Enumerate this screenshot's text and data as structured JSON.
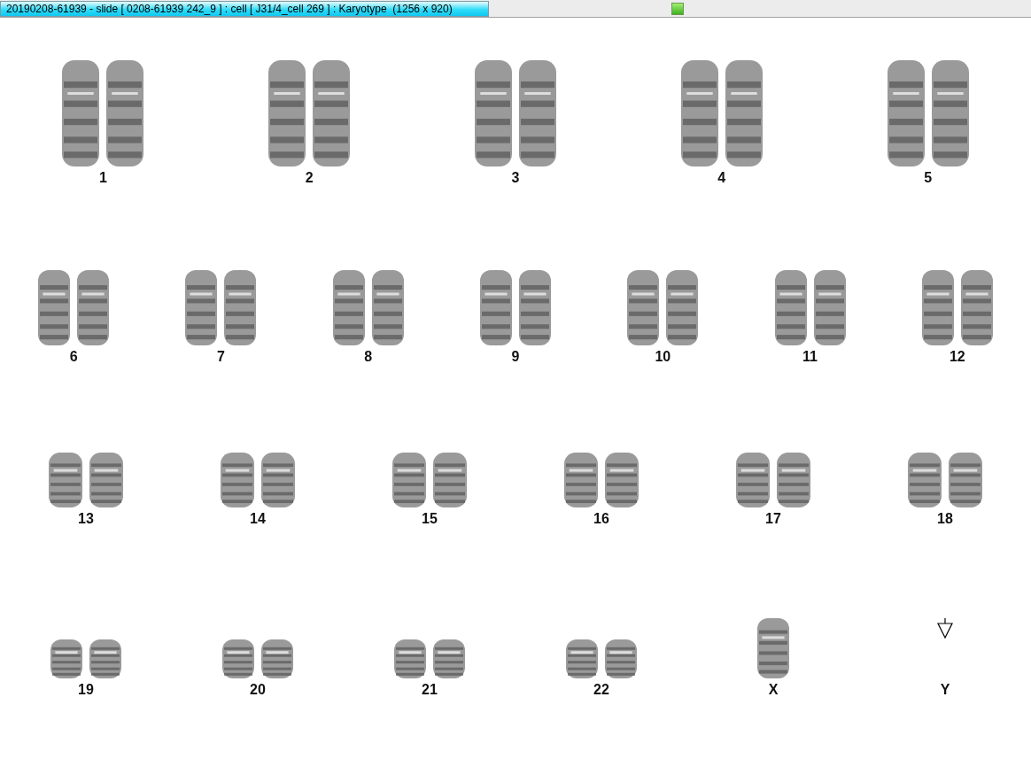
{
  "window": {
    "title": "20190208-61939 - slide [ 0208-61939 242_9 ] : cell [ J31/4_cell 269 ] : Karyotype  (1256 x 920)"
  },
  "rows": [
    {
      "slots": [
        {
          "label": "1",
          "kind": "pair"
        },
        {
          "label": "2",
          "kind": "pair"
        },
        {
          "label": "3",
          "kind": "pair"
        },
        {
          "label": "4",
          "kind": "pair"
        },
        {
          "label": "5",
          "kind": "pair"
        }
      ]
    },
    {
      "slots": [
        {
          "label": "6",
          "kind": "pair"
        },
        {
          "label": "7",
          "kind": "pair"
        },
        {
          "label": "8",
          "kind": "pair"
        },
        {
          "label": "9",
          "kind": "pair"
        },
        {
          "label": "10",
          "kind": "pair"
        },
        {
          "label": "11",
          "kind": "pair"
        },
        {
          "label": "12",
          "kind": "pair"
        }
      ]
    },
    {
      "slots": [
        {
          "label": "13",
          "kind": "pair"
        },
        {
          "label": "14",
          "kind": "pair"
        },
        {
          "label": "15",
          "kind": "pair"
        },
        {
          "label": "16",
          "kind": "pair"
        },
        {
          "label": "17",
          "kind": "pair"
        },
        {
          "label": "18",
          "kind": "pair"
        }
      ]
    },
    {
      "slots": [
        {
          "label": "19",
          "kind": "pair"
        },
        {
          "label": "20",
          "kind": "pair"
        },
        {
          "label": "21",
          "kind": "pair"
        },
        {
          "label": "22",
          "kind": "pair"
        },
        {
          "label": "X",
          "kind": "single"
        },
        {
          "label": "Y",
          "kind": "marker"
        }
      ]
    }
  ]
}
